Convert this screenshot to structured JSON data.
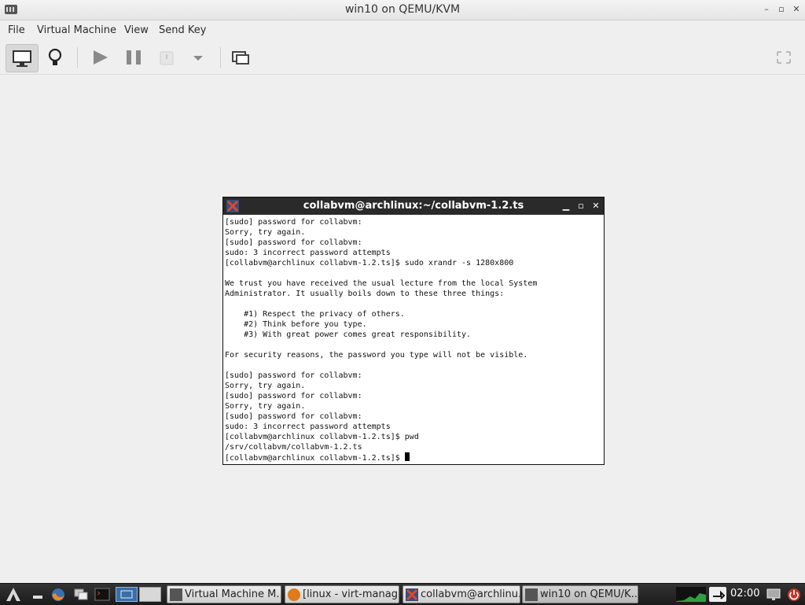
{
  "window": {
    "title": "win10 on QEMU/KVM"
  },
  "menubar": {
    "items": [
      "File",
      "Virtual Machine",
      "View",
      "Send Key"
    ]
  },
  "terminal": {
    "title": "collabvm@archlinux:~/collabvm-1.2.ts",
    "lines": [
      "[sudo] password for collabvm:",
      "Sorry, try again.",
      "[sudo] password for collabvm:",
      "sudo: 3 incorrect password attempts",
      "[collabvm@archlinux collabvm-1.2.ts]$ sudo xrandr -s 1280x800",
      "",
      "We trust you have received the usual lecture from the local System",
      "Administrator. It usually boils down to these three things:",
      "",
      "    #1) Respect the privacy of others.",
      "    #2) Think before you type.",
      "    #3) With great power comes great responsibility.",
      "",
      "For security reasons, the password you type will not be visible.",
      "",
      "[sudo] password for collabvm:",
      "Sorry, try again.",
      "[sudo] password for collabvm:",
      "Sorry, try again.",
      "[sudo] password for collabvm:",
      "sudo: 3 incorrect password attempts",
      "[collabvm@archlinux collabvm-1.2.ts]$ pwd",
      "/srv/collabvm/collabvm-1.2.ts"
    ],
    "prompt": "[collabvm@archlinux collabvm-1.2.ts]$ "
  },
  "taskbar": {
    "tasks": [
      "Virtual Machine M...",
      "[linux - virt-manag...",
      "collabvm@archlinu...",
      "win10 on QEMU/K..."
    ],
    "clock": "02:00"
  },
  "colors": {
    "titlebar_dark": "#2a2a2a",
    "taskbar": "#1b1b1b",
    "background": "#efefef"
  }
}
